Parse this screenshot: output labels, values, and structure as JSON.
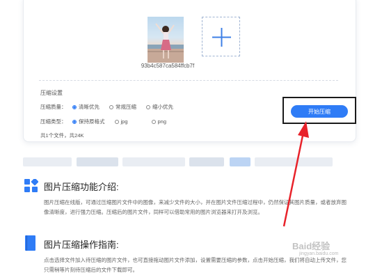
{
  "upload": {
    "file_name": "93b4c587ca584ffcb7f"
  },
  "settings": {
    "title": "压缩设置",
    "quality_label": "压缩质量：",
    "quality_options": [
      {
        "label": "清晰优先",
        "selected": true
      },
      {
        "label": "常规压缩",
        "selected": false
      },
      {
        "label": "缩小优先",
        "selected": false
      }
    ],
    "type_label": "压缩类型：",
    "type_options": [
      {
        "label": "保持原格式",
        "selected": true
      },
      {
        "label": "jpg",
        "selected": false
      },
      {
        "label": "png",
        "selected": false
      }
    ],
    "summary": "共1个文件，共24K"
  },
  "start_button_label": "开始压缩",
  "section1": {
    "title": "图片压缩功能介绍:",
    "text": "图片压缩在线版，可通过压缩图片文件中的图像，来减少文件的大小，并在图片文件压缩过程中，仍然保证其图片质量，或者放弃图像清晰度，进行强力压缩。压缩后的图片文件，同样可以借助常用的图片浏览器来打开及浏览。"
  },
  "section2": {
    "title": "图片压缩操作指南:",
    "text": "点击选择文件加入待压缩的图片文件，也可直接拖动图片文件添加，设置需要压缩的参数，点击开始压缩，我们将自动上传文件，您只需稍等片刻待压缩后的文件下载即可。"
  },
  "watermark": {
    "brand": "Baid经验",
    "sub": "jingyan.baidu.com"
  },
  "colors": {
    "accent": "#2f7cf6",
    "arrow": "#e8222a"
  }
}
